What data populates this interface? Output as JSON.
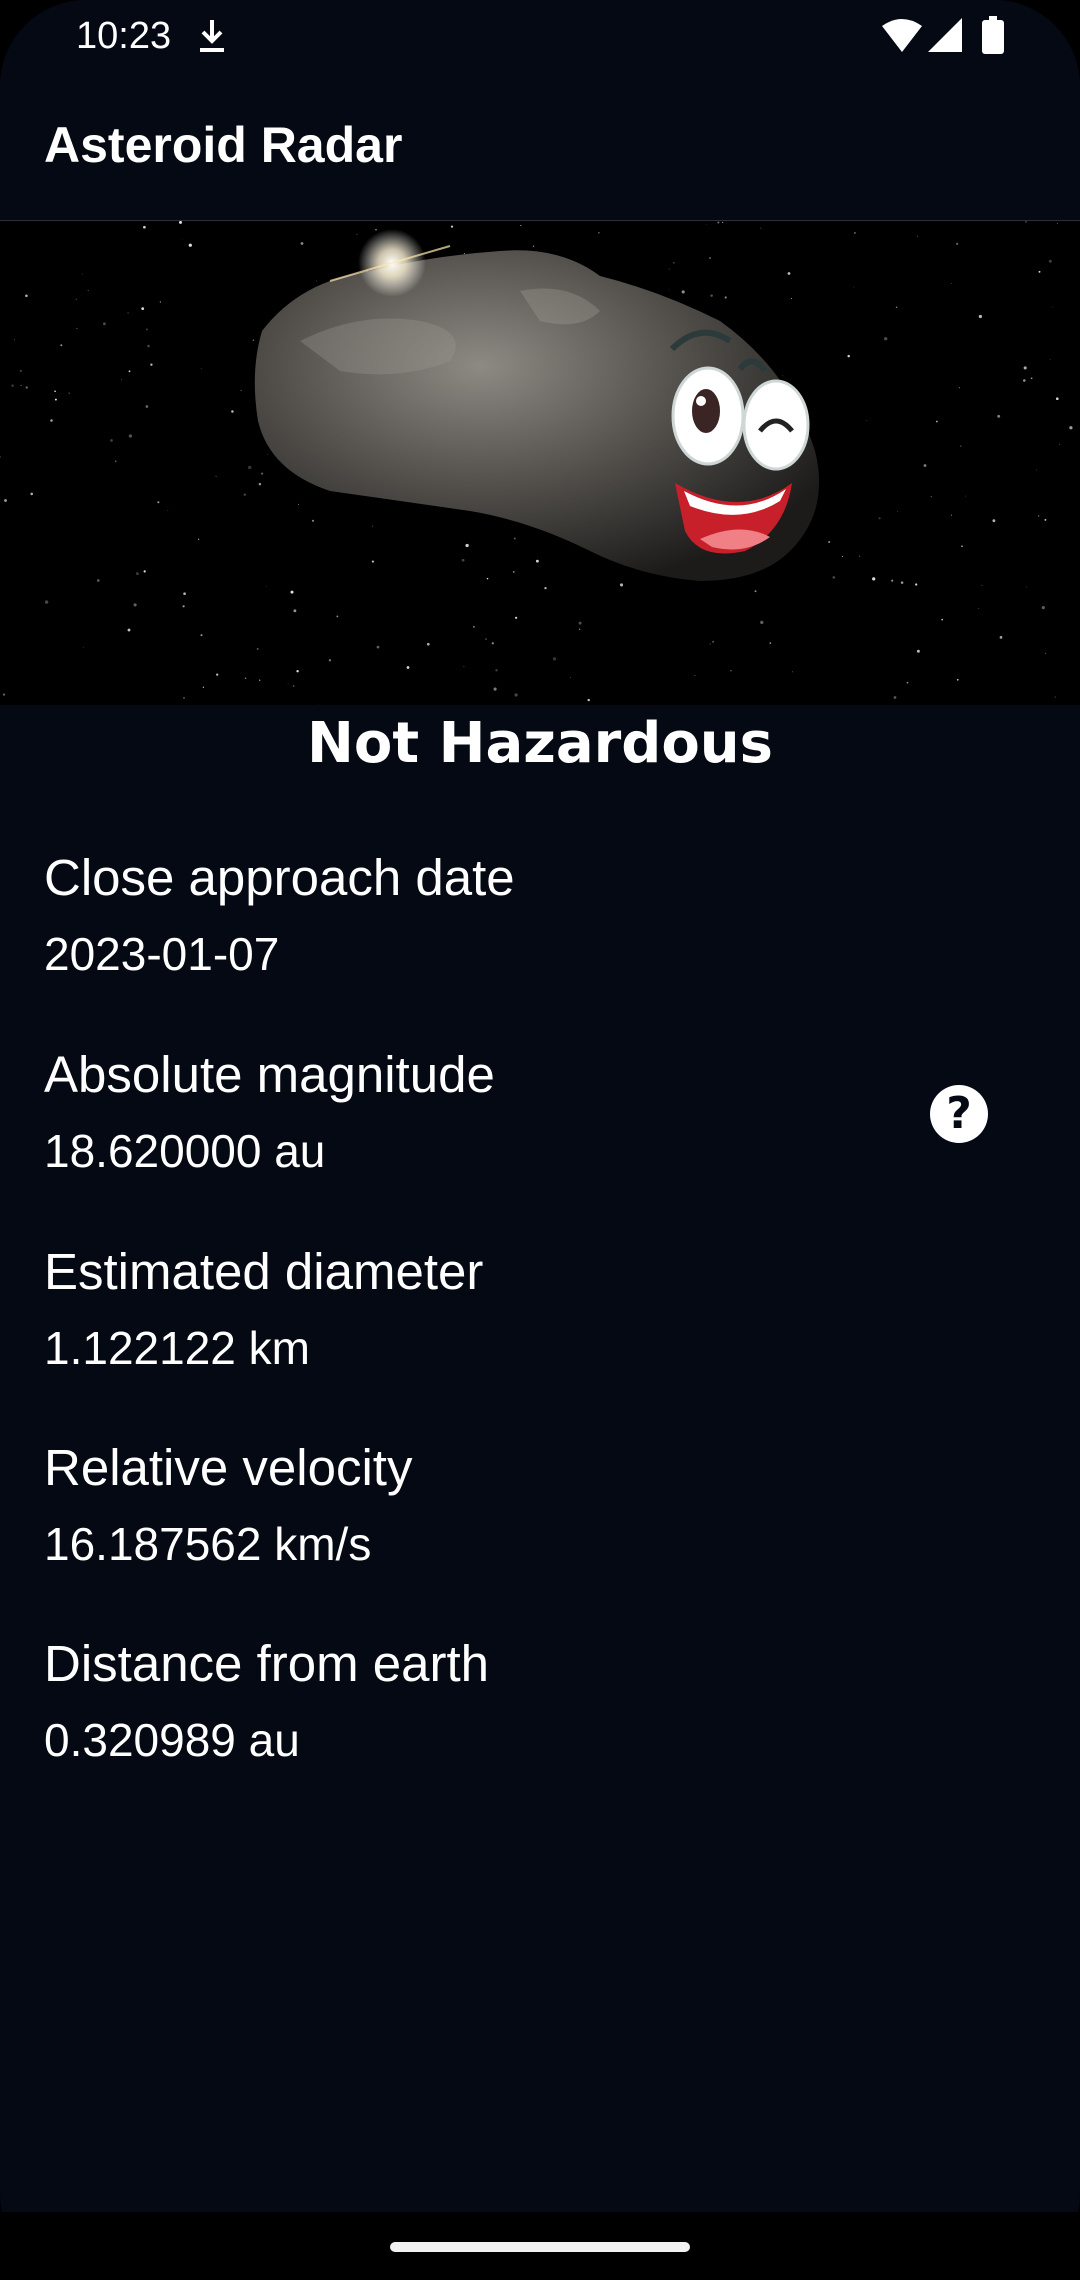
{
  "status_bar": {
    "time": "10:23",
    "icons": [
      "download-icon",
      "wifi-icon",
      "signal-icon",
      "battery-icon"
    ]
  },
  "app_bar": {
    "title": "Asteroid Radar"
  },
  "hero": {
    "image": "happy-asteroid-image"
  },
  "hazard_status": "Not Hazardous",
  "details": [
    {
      "label": "Close approach date",
      "value": "2023-01-07"
    },
    {
      "label": "Absolute magnitude",
      "value": "18.620000 au"
    },
    {
      "label": "Estimated diameter",
      "value": "1.122122 km"
    },
    {
      "label": "Relative velocity",
      "value": "16.187562 km/s"
    },
    {
      "label": "Distance from earth",
      "value": "0.320989 au"
    }
  ],
  "help_button": {
    "label": "?"
  },
  "colors": {
    "background": "#050914",
    "text": "#ffffff"
  }
}
